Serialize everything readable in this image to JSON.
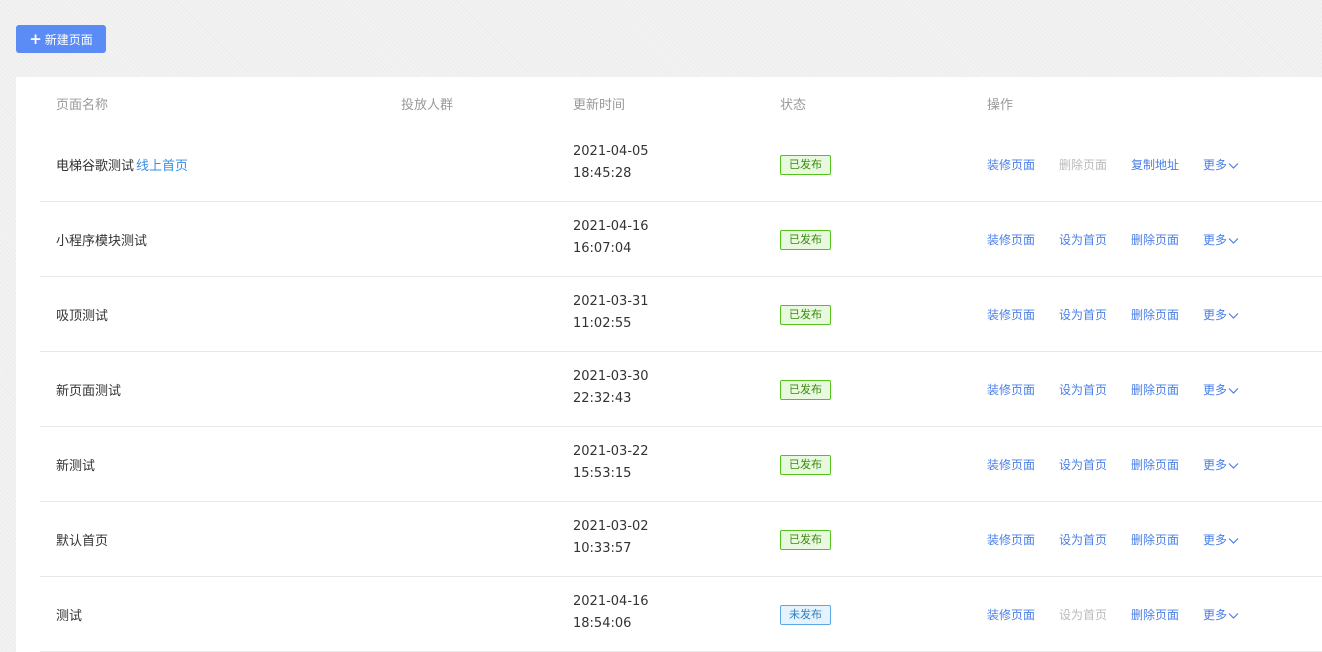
{
  "toolbar": {
    "new_page_icon": "plus-icon",
    "new_page_label": "新建页面"
  },
  "table": {
    "columns": [
      "页面名称",
      "投放人群",
      "更新时间",
      "状态",
      "操作"
    ],
    "rows": [
      {
        "name": "电梯谷歌测试",
        "home_tag": "线上首页",
        "date": "2021-04-05",
        "time": "18:45:28",
        "status": "已发布",
        "published": true,
        "actions": [
          {
            "label": "装修页面",
            "enabled": true
          },
          {
            "label": "删除页面",
            "enabled": false
          },
          {
            "label": "复制地址",
            "enabled": true
          },
          {
            "label": "更多",
            "enabled": true
          }
        ]
      },
      {
        "name": "小程序模块测试",
        "home_tag": "",
        "date": "2021-04-16",
        "time": "16:07:04",
        "status": "已发布",
        "published": true,
        "actions": [
          {
            "label": "装修页面",
            "enabled": true
          },
          {
            "label": "设为首页",
            "enabled": true
          },
          {
            "label": "删除页面",
            "enabled": true
          },
          {
            "label": "更多",
            "enabled": true
          }
        ]
      },
      {
        "name": "吸顶测试",
        "home_tag": "",
        "date": "2021-03-31",
        "time": "11:02:55",
        "status": "已发布",
        "published": true,
        "actions": [
          {
            "label": "装修页面",
            "enabled": true
          },
          {
            "label": "设为首页",
            "enabled": true
          },
          {
            "label": "删除页面",
            "enabled": true
          },
          {
            "label": "更多",
            "enabled": true
          }
        ]
      },
      {
        "name": "新页面测试",
        "home_tag": "",
        "date": "2021-03-30",
        "time": "22:32:43",
        "status": "已发布",
        "published": true,
        "actions": [
          {
            "label": "装修页面",
            "enabled": true
          },
          {
            "label": "设为首页",
            "enabled": true
          },
          {
            "label": "删除页面",
            "enabled": true
          },
          {
            "label": "更多",
            "enabled": true
          }
        ]
      },
      {
        "name": "新测试",
        "home_tag": "",
        "date": "2021-03-22",
        "time": "15:53:15",
        "status": "已发布",
        "published": true,
        "actions": [
          {
            "label": "装修页面",
            "enabled": true
          },
          {
            "label": "设为首页",
            "enabled": true
          },
          {
            "label": "删除页面",
            "enabled": true
          },
          {
            "label": "更多",
            "enabled": true
          }
        ]
      },
      {
        "name": "默认首页",
        "home_tag": "",
        "date": "2021-03-02",
        "time": "10:33:57",
        "status": "已发布",
        "published": true,
        "actions": [
          {
            "label": "装修页面",
            "enabled": true
          },
          {
            "label": "设为首页",
            "enabled": true
          },
          {
            "label": "删除页面",
            "enabled": true
          },
          {
            "label": "更多",
            "enabled": true
          }
        ]
      },
      {
        "name": "测试",
        "home_tag": "",
        "date": "2021-04-16",
        "time": "18:54:06",
        "status": "未发布",
        "published": false,
        "actions": [
          {
            "label": "装修页面",
            "enabled": true
          },
          {
            "label": "设为首页",
            "enabled": false
          },
          {
            "label": "删除页面",
            "enabled": true
          },
          {
            "label": "更多",
            "enabled": true
          }
        ]
      }
    ]
  },
  "colors": {
    "primary": "#5b8cf5",
    "link": "#4a7fe8",
    "published_green": "#52c41a",
    "unpublished_blue": "#5aa9e6",
    "disabled": "#bbbbbb"
  }
}
